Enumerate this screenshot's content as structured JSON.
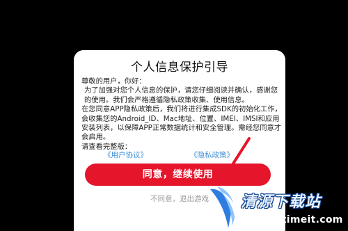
{
  "dialog": {
    "title": "个人信息保护引导",
    "greeting": "尊敬的用户，你好：",
    "paragraph_1": "为了加强对您个人信息的保护，请您仔细阅读并确认，感谢您的使用。我们会严格遵循隐私政策收集、使用信息。",
    "paragraph_2": "在您同意APP隐私政策后，我们将进行集成SDK的初始化工作，会收集您的Android_ID、Mac地址、位置、IMEI、IMSI和应用安装列表，以保障APP正常数据统计和安全管理。需经您同意才会启用。",
    "full_version_prompt": "请查看完整版：",
    "user_agreement_link": "《用户协议》",
    "privacy_policy_link": "《隐私政策》",
    "agree_button": "同意，继续使用",
    "disagree_link": "不同意，退出游戏"
  },
  "watermark": {
    "title": "清源下载站",
    "url": "www.fotimeit.com"
  },
  "colors": {
    "agree_button": "#e5152b",
    "link": "#3f8fd6",
    "disagree_text": "#9a9a9a",
    "background": "#000000",
    "dialog": "#ffffff"
  }
}
